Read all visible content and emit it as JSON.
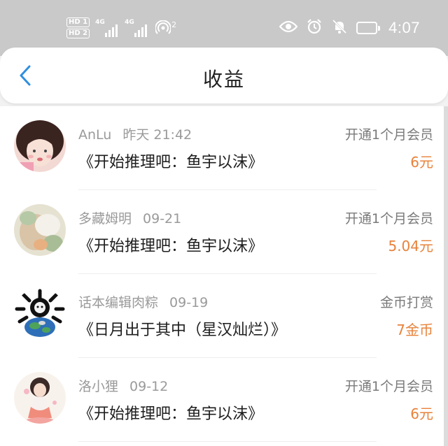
{
  "status_bar": {
    "hd_1": "HD 1",
    "hd_2": "HD 2",
    "network_1": "4G",
    "network_2": "4G",
    "hotspot_count": "2",
    "time": "4:07"
  },
  "header": {
    "title": "收益"
  },
  "items": [
    {
      "name": "AnLu",
      "date": "昨天 21:42",
      "book": "《开始推理吧：鱼宇以沫》",
      "kind": "开通1个月会员",
      "amount": "6元"
    },
    {
      "name": "多藏姆明",
      "date": "09-21",
      "book": "《开始推理吧：鱼宇以沫》",
      "kind": "开通1个月会员",
      "amount": "5.04元"
    },
    {
      "name": "话本编辑肉粽",
      "date": "09-19",
      "book": "《日月出于其中（星汉灿烂）》",
      "kind": "金币打赏",
      "amount": "7金币"
    },
    {
      "name": "洛小狸",
      "date": "09-12",
      "book": "《开始推理吧：鱼宇以沫》",
      "kind": "开通1个月会员",
      "amount": "6元"
    }
  ],
  "colors": {
    "status_bar_bg": "#c9c9c9",
    "accent_blue": "#2f8fe0",
    "amount_orange": "#e8823a"
  },
  "icons": [
    "back-arrow-icon",
    "eye-icon",
    "alarm-icon",
    "bell-off-icon",
    "battery-icon",
    "hotspot-icon",
    "signal-icon"
  ]
}
